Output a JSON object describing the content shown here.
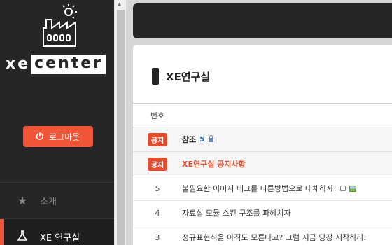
{
  "sidebar": {
    "logo": {
      "part1": "xe",
      "part2": "center"
    },
    "logout_label": "로그아웃",
    "nav": [
      {
        "label": "소개",
        "icon": "star-icon"
      },
      {
        "label": "XE 연구실",
        "icon": "flask-icon"
      }
    ]
  },
  "board": {
    "title": "XE연구실",
    "col_number": "번호",
    "rows": [
      {
        "no": "공지",
        "notice": true,
        "title": "참조",
        "count": "5",
        "icons": [
          "lock-icon"
        ]
      },
      {
        "no": "공지",
        "notice": true,
        "title": "XE연구실 공지사항",
        "icons": []
      },
      {
        "no": "5",
        "notice": false,
        "title": "불필요한 이미지 태그를 다른방법으로 대체하자!",
        "icons": [
          "doc-icon",
          "image-icon"
        ]
      },
      {
        "no": "4",
        "notice": false,
        "title": "자료실 모듈 스킨 구조를 파헤치자",
        "icons": []
      },
      {
        "no": "3",
        "notice": false,
        "title": "정규표현식을 아직도 모른다고? 그럼 지금 당장 시작하라.",
        "icons": []
      }
    ]
  },
  "colors": {
    "accent": "#f05537",
    "sidebar": "#262626",
    "link_red": "#e24b2c",
    "count_blue": "#2b66c2"
  }
}
